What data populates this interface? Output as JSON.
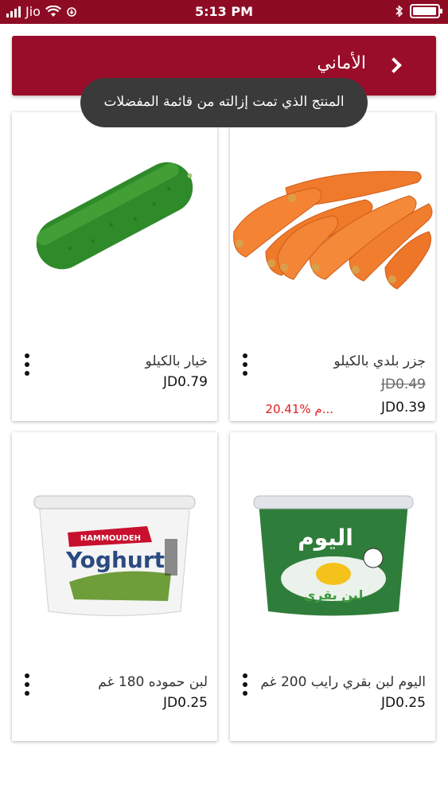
{
  "status_bar": {
    "carrier": "Jio",
    "time": "5:13 PM",
    "battery_level": 0.95
  },
  "header": {
    "title": "الأماني"
  },
  "toast": {
    "message": "المنتج الذي تمت إزالته من قائمة المفضلات"
  },
  "products": [
    {
      "name": "جزر بلدي بالكيلو",
      "old_price": "JD0.49",
      "price": "JD0.39",
      "discount": "20.41% م..."
    },
    {
      "name": "خيار بالكيلو",
      "price": "JD0.79"
    },
    {
      "name": "اليوم لبن بقري رايب 200 غم",
      "price": "JD0.25",
      "brand_text": "اليوم",
      "sub_text": "لبن بقري"
    },
    {
      "name": "لبن حموده 180 غم",
      "price": "JD0.25",
      "brand_text": "HAMMOUDEH",
      "sub_text": "Yoghurt"
    }
  ],
  "colors": {
    "brand": "#9a0d2a",
    "status_bar": "#8e0b24",
    "discount": "#e02020",
    "toast": "#3a3a3a"
  }
}
